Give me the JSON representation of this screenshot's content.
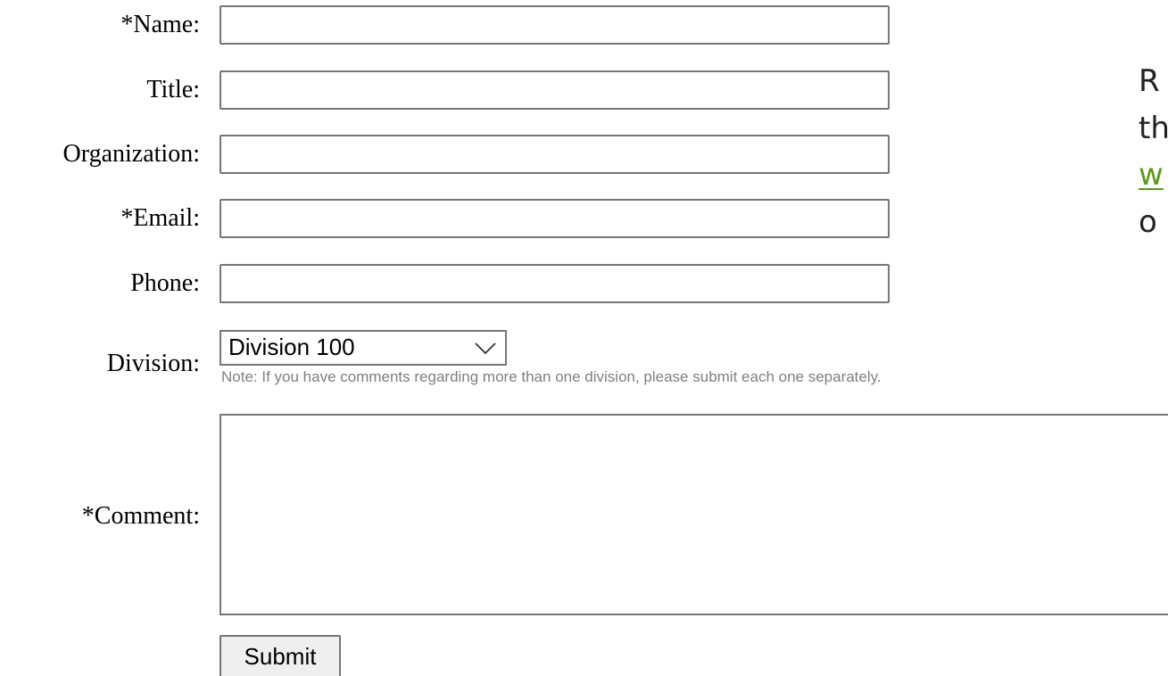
{
  "form": {
    "name_label": "*Name:",
    "title_label": "Title:",
    "organization_label": "Organization:",
    "email_label": "*Email:",
    "phone_label": "Phone:",
    "division_label": "Division:",
    "division_selected": "Division 100",
    "division_note": "Note: If you have comments regarding more than one division, please submit each one separately.",
    "comment_label": "*Comment:",
    "submit_label": "Submit"
  },
  "sidebar_text": {
    "line1": "R",
    "line2": "th",
    "line3_link": "w",
    "line4": "o"
  },
  "colors": {
    "link": "#5a9a1a",
    "note": "#808080",
    "border": "#767676"
  },
  "icons": {
    "dropdown": "chevron-down-icon"
  }
}
